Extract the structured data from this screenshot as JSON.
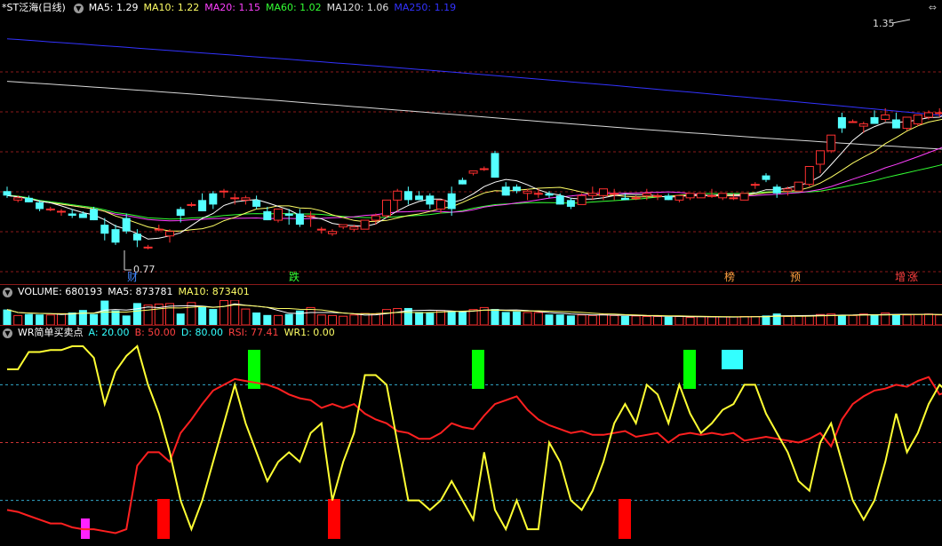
{
  "main": {
    "title": "*ST泛海(日线)",
    "ma": [
      {
        "label": "MA5: 1.29",
        "color": "#ffffff"
      },
      {
        "label": "MA10: 1.22",
        "color": "#ffff66"
      },
      {
        "label": "MA20: 1.15",
        "color": "#ff40ff"
      },
      {
        "label": "MA60: 1.02",
        "color": "#33ff33"
      },
      {
        "label": "MA120: 1.06",
        "color": "#e0e0e0"
      },
      {
        "label": "MA250: 1.19",
        "color": "#3333ff"
      }
    ],
    "collapse_icon": "chevron-down-icon",
    "corner_icon": "double-chevron-icon",
    "high_label": "1.35",
    "low_label": "0.77",
    "events": [
      {
        "label": "财",
        "color": "#4488ff"
      },
      {
        "label": "跌",
        "color": "#33ff33"
      },
      {
        "label": "榜",
        "color": "#ffa040"
      },
      {
        "label": "预",
        "color": "#ffa040"
      },
      {
        "label": "增",
        "color": "#ff4040"
      },
      {
        "label": "涨",
        "color": "#ff4040"
      }
    ]
  },
  "volume": {
    "title": "VOLUME: 680193",
    "ma5": "MA5: 873781",
    "ma10": "MA10: 873401"
  },
  "wr": {
    "title": "WR简单买卖点",
    "params": [
      {
        "label": "A: 20.00",
        "color": "#33ffff"
      },
      {
        "label": "B: 50.00",
        "color": "#ff4040"
      },
      {
        "label": "D: 80.00",
        "color": "#33ffff"
      },
      {
        "label": "RSI: 77.41",
        "color": "#ff4040"
      },
      {
        "label": "WR1: 0.00",
        "color": "#ffff66"
      }
    ]
  },
  "colors": {
    "up": "#ff3030",
    "down": "#54ffff",
    "grid": "#8b1a1a"
  },
  "candles": [
    [
      1.37,
      1.39,
      1.34,
      1.35
    ],
    [
      1.33,
      1.35,
      1.32,
      1.34
    ],
    [
      1.34,
      1.35,
      1.32,
      1.32
    ],
    [
      1.32,
      1.33,
      1.28,
      1.29
    ],
    [
      1.29,
      1.3,
      1.28,
      1.29
    ],
    [
      1.28,
      1.29,
      1.26,
      1.28
    ],
    [
      1.27,
      1.29,
      1.25,
      1.26
    ],
    [
      1.27,
      1.28,
      1.25,
      1.25
    ],
    [
      1.29,
      1.3,
      1.24,
      1.24
    ],
    [
      1.22,
      1.25,
      1.15,
      1.18
    ],
    [
      1.2,
      1.22,
      1.13,
      1.14
    ],
    [
      1.25,
      1.27,
      1.18,
      1.19
    ],
    [
      1.18,
      1.2,
      1.12,
      1.15
    ],
    [
      1.12,
      1.13,
      1.11,
      1.12
    ],
    [
      1.2,
      1.22,
      1.19,
      1.2
    ],
    [
      1.17,
      1.2,
      1.14,
      1.19
    ],
    [
      1.29,
      1.3,
      1.23,
      1.26
    ],
    [
      1.31,
      1.32,
      1.3,
      1.31
    ],
    [
      1.33,
      1.36,
      1.28,
      1.28
    ],
    [
      1.36,
      1.37,
      1.29,
      1.31
    ],
    [
      1.37,
      1.38,
      1.34,
      1.37
    ],
    [
      1.34,
      1.36,
      1.31,
      1.34
    ],
    [
      1.33,
      1.35,
      1.31,
      1.34
    ],
    [
      1.33,
      1.35,
      1.29,
      1.3
    ],
    [
      1.28,
      1.3,
      1.24,
      1.24
    ],
    [
      1.24,
      1.29,
      1.23,
      1.29
    ],
    [
      1.27,
      1.29,
      1.22,
      1.26
    ],
    [
      1.27,
      1.29,
      1.21,
      1.22
    ],
    [
      1.26,
      1.28,
      1.21,
      1.26
    ],
    [
      1.2,
      1.21,
      1.18,
      1.2
    ],
    [
      1.18,
      1.2,
      1.17,
      1.19
    ],
    [
      1.21,
      1.22,
      1.2,
      1.22
    ],
    [
      1.2,
      1.22,
      1.19,
      1.21
    ],
    [
      1.2,
      1.24,
      1.2,
      1.24
    ],
    [
      1.24,
      1.27,
      1.22,
      1.26
    ],
    [
      1.26,
      1.33,
      1.25,
      1.33
    ],
    [
      1.33,
      1.38,
      1.28,
      1.37
    ],
    [
      1.37,
      1.39,
      1.31,
      1.33
    ],
    [
      1.35,
      1.37,
      1.33,
      1.33
    ],
    [
      1.35,
      1.36,
      1.29,
      1.31
    ],
    [
      1.29,
      1.33,
      1.27,
      1.33
    ],
    [
      1.36,
      1.39,
      1.26,
      1.29
    ],
    [
      1.42,
      1.43,
      1.4,
      1.4
    ],
    [
      1.45,
      1.46,
      1.44,
      1.46
    ],
    [
      1.47,
      1.48,
      1.46,
      1.47
    ],
    [
      1.54,
      1.55,
      1.43,
      1.43
    ],
    [
      1.39,
      1.41,
      1.35,
      1.35
    ],
    [
      1.39,
      1.4,
      1.36,
      1.37
    ],
    [
      1.36,
      1.38,
      1.33,
      1.37
    ],
    [
      1.36,
      1.38,
      1.34,
      1.36
    ],
    [
      1.36,
      1.37,
      1.34,
      1.35
    ],
    [
      1.35,
      1.36,
      1.31,
      1.31
    ],
    [
      1.33,
      1.34,
      1.29,
      1.3
    ],
    [
      1.31,
      1.36,
      1.31,
      1.35
    ],
    [
      1.35,
      1.39,
      1.33,
      1.36
    ],
    [
      1.35,
      1.38,
      1.33,
      1.38
    ],
    [
      1.36,
      1.38,
      1.33,
      1.36
    ],
    [
      1.34,
      1.36,
      1.33,
      1.33
    ],
    [
      1.34,
      1.35,
      1.33,
      1.34
    ],
    [
      1.35,
      1.38,
      1.33,
      1.36
    ],
    [
      1.35,
      1.36,
      1.33,
      1.35
    ],
    [
      1.35,
      1.36,
      1.33,
      1.33
    ],
    [
      1.33,
      1.35,
      1.32,
      1.35
    ],
    [
      1.34,
      1.36,
      1.33,
      1.36
    ],
    [
      1.34,
      1.36,
      1.34,
      1.36
    ],
    [
      1.35,
      1.38,
      1.34,
      1.35
    ],
    [
      1.34,
      1.36,
      1.33,
      1.36
    ],
    [
      1.34,
      1.36,
      1.33,
      1.34
    ],
    [
      1.33,
      1.36,
      1.33,
      1.36
    ],
    [
      1.4,
      1.41,
      1.38,
      1.4
    ],
    [
      1.44,
      1.45,
      1.41,
      1.42
    ],
    [
      1.39,
      1.4,
      1.34,
      1.36
    ],
    [
      1.37,
      1.39,
      1.35,
      1.38
    ],
    [
      1.37,
      1.41,
      1.37,
      1.41
    ],
    [
      1.4,
      1.48,
      1.39,
      1.48
    ],
    [
      1.49,
      1.55,
      1.45,
      1.55
    ],
    [
      1.55,
      1.62,
      1.54,
      1.62
    ],
    [
      1.7,
      1.72,
      1.63,
      1.65
    ],
    [
      1.68,
      1.69,
      1.68,
      1.68
    ],
    [
      1.66,
      1.68,
      1.63,
      1.67
    ],
    [
      1.7,
      1.73,
      1.67,
      1.67
    ],
    [
      1.69,
      1.74,
      1.68,
      1.71
    ],
    [
      1.69,
      1.72,
      1.65,
      1.65
    ],
    [
      1.65,
      1.7,
      1.64,
      1.7
    ],
    [
      1.67,
      1.71,
      1.66,
      1.71
    ],
    [
      1.7,
      1.73,
      1.69,
      1.72
    ],
    [
      1.72,
      1.74,
      1.7,
      1.72
    ],
    [
      1.73,
      1.76,
      1.72,
      1.76
    ],
    [
      1.74,
      1.76,
      1.73,
      1.76
    ],
    [
      1.75,
      1.77,
      1.74,
      1.76
    ],
    [
      1.75,
      1.8,
      1.74,
      1.79
    ],
    [
      1.77,
      1.83,
      1.75,
      1.81
    ],
    [
      1.8,
      1.83,
      1.79,
      1.83
    ],
    [
      1.85,
      1.88,
      1.85,
      1.88
    ],
    [
      1.86,
      1.92,
      1.84,
      1.92
    ],
    [
      1.96,
      1.97,
      1.9,
      1.92
    ],
    [
      1.96,
      2.02,
      1.95,
      2.02
    ],
    [
      2.02,
      2.04,
      1.97,
      1.98
    ],
    [
      2.0,
      2.05,
      1.99,
      2.05
    ]
  ],
  "volumes": [
    62,
    38,
    44,
    42,
    40,
    45,
    50,
    60,
    44,
    98,
    58,
    38,
    88,
    80,
    84,
    86,
    46,
    90,
    72,
    64,
    98,
    100,
    64,
    50,
    40,
    38,
    44,
    58,
    70,
    40,
    38,
    35,
    40,
    46,
    44,
    62,
    66,
    68,
    52,
    48,
    58,
    56,
    52,
    62,
    70,
    64,
    52,
    54,
    50,
    50,
    42,
    42,
    38,
    40,
    38,
    42,
    38,
    36,
    36,
    34,
    34,
    33,
    34,
    30,
    33,
    32,
    32,
    32,
    34,
    34,
    38,
    46,
    34,
    36,
    36,
    42,
    44,
    40,
    38,
    44,
    40,
    48,
    42,
    40,
    42,
    44,
    40,
    40,
    38,
    36,
    34,
    36,
    38,
    34,
    40,
    38,
    36,
    40,
    38
  ],
  "wr_values": [
    88,
    88,
    97,
    97,
    98,
    98,
    100,
    100,
    94,
    70,
    87,
    95,
    100,
    80,
    65,
    45,
    20,
    5,
    20,
    40,
    60,
    80,
    60,
    45,
    30,
    40,
    45,
    40,
    55,
    60,
    20,
    40,
    55,
    85,
    85,
    80,
    50,
    20,
    20,
    15,
    20,
    30,
    20,
    10,
    45,
    15,
    5,
    20,
    5,
    5,
    50,
    40,
    20,
    15,
    25,
    40,
    60,
    70,
    60,
    80,
    75,
    60,
    80,
    65,
    55,
    60,
    67,
    70,
    80,
    80,
    65,
    55,
    45,
    30,
    25,
    50,
    60,
    40,
    20,
    10,
    20,
    40,
    65,
    45,
    55,
    70,
    80,
    75,
    60,
    55,
    40,
    25,
    20,
    30,
    40,
    35,
    30,
    25,
    5
  ],
  "rsi_values": [
    15,
    14,
    12,
    10,
    8,
    8,
    6,
    5,
    5,
    4,
    3,
    5,
    38,
    45,
    45,
    40,
    55,
    62,
    70,
    77,
    80,
    83,
    82,
    81,
    80,
    78,
    75,
    73,
    72,
    68,
    70,
    68,
    70,
    65,
    62,
    60,
    56,
    55,
    52,
    52,
    55,
    60,
    58,
    57,
    64,
    70,
    72,
    74,
    67,
    62,
    59,
    57,
    55,
    56,
    54,
    54,
    55,
    56,
    53,
    54,
    55,
    50,
    54,
    55,
    54,
    55,
    54,
    55,
    51,
    52,
    53,
    52,
    51,
    50,
    52,
    55,
    48,
    62,
    70,
    74,
    77,
    78,
    80,
    79,
    82,
    84,
    75,
    77,
    78,
    85,
    85,
    78,
    82,
    86,
    86,
    90,
    93,
    94
  ]
}
